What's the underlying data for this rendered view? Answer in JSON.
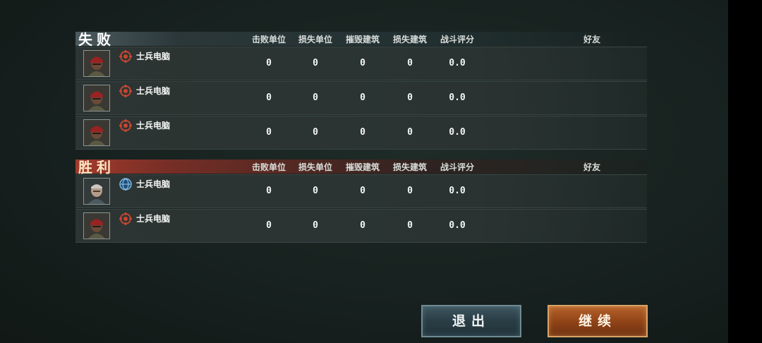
{
  "columns": [
    "击败单位",
    "损失单位",
    "摧毁建筑",
    "损失建筑",
    "战斗评分",
    "好友"
  ],
  "lose_section": {
    "title": "失败",
    "players": [
      {
        "name": "士兵电脑",
        "faction_icon": "red-faction-emblem-icon",
        "defeated": "0",
        "lost_units": "0",
        "destroyed": "0",
        "lost_buildings": "0",
        "score": "0.0"
      },
      {
        "name": "士兵电脑",
        "faction_icon": "red-faction-emblem-icon",
        "defeated": "0",
        "lost_units": "0",
        "destroyed": "0",
        "lost_buildings": "0",
        "score": "0.0"
      },
      {
        "name": "士兵电脑",
        "faction_icon": "red-faction-emblem-icon",
        "defeated": "0",
        "lost_units": "0",
        "destroyed": "0",
        "lost_buildings": "0",
        "score": "0.0"
      }
    ]
  },
  "win_section": {
    "title": "胜利",
    "players": [
      {
        "name": "士兵电脑",
        "faction_icon": "blue-faction-emblem-icon",
        "defeated": "0",
        "lost_units": "0",
        "destroyed": "0",
        "lost_buildings": "0",
        "score": "0.0"
      },
      {
        "name": "士兵电脑",
        "faction_icon": "red-faction-emblem-icon",
        "defeated": "0",
        "lost_units": "0",
        "destroyed": "0",
        "lost_buildings": "0",
        "score": "0.0"
      }
    ]
  },
  "buttons": {
    "exit": "退出",
    "continue": "继续"
  },
  "colors": {
    "lose_accent": "#6a7f8a",
    "win_accent": "#b0412f",
    "exit_button": "#2f4650",
    "continue_button": "#a0501f"
  }
}
